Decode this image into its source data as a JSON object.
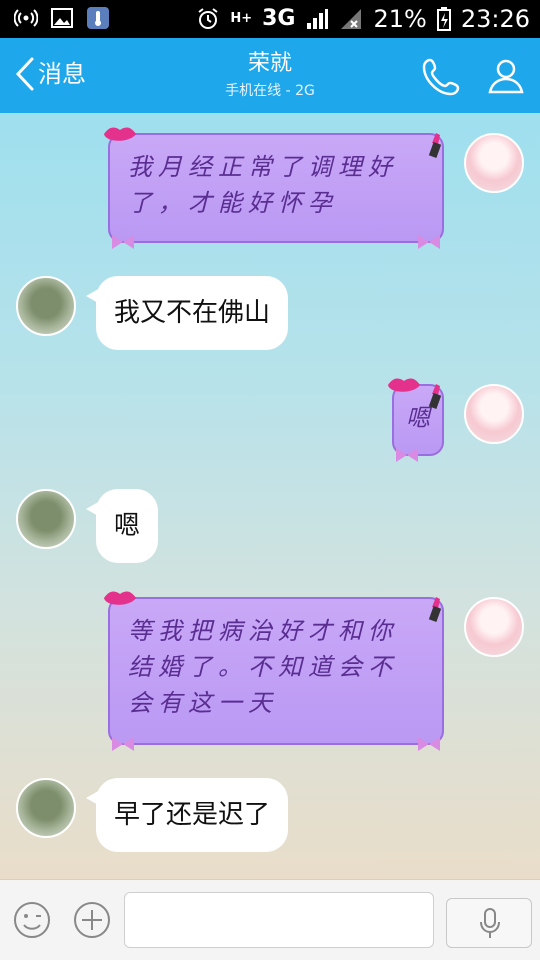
{
  "status_bar": {
    "network": "3G",
    "battery": "21%",
    "time": "23:26"
  },
  "header": {
    "back_label": "消息",
    "title": "荣就",
    "subtitle": "手机在线 - 2G"
  },
  "messages": [
    {
      "sender": "me",
      "text": "我月经正常了调理好了，才能好怀孕"
    },
    {
      "sender": "peer",
      "text": "我又不在佛山"
    },
    {
      "sender": "me",
      "text": "嗯"
    },
    {
      "sender": "peer",
      "text": "嗯"
    },
    {
      "sender": "me",
      "text": "等我把病治好才和你结婚了。不知道会不会有这一天"
    },
    {
      "sender": "peer",
      "text": "早了还是迟了"
    }
  ],
  "colors": {
    "header": "#1ea7ea",
    "fancy_bubble": "#c4a3f6",
    "fancy_text": "#5a2d91"
  }
}
